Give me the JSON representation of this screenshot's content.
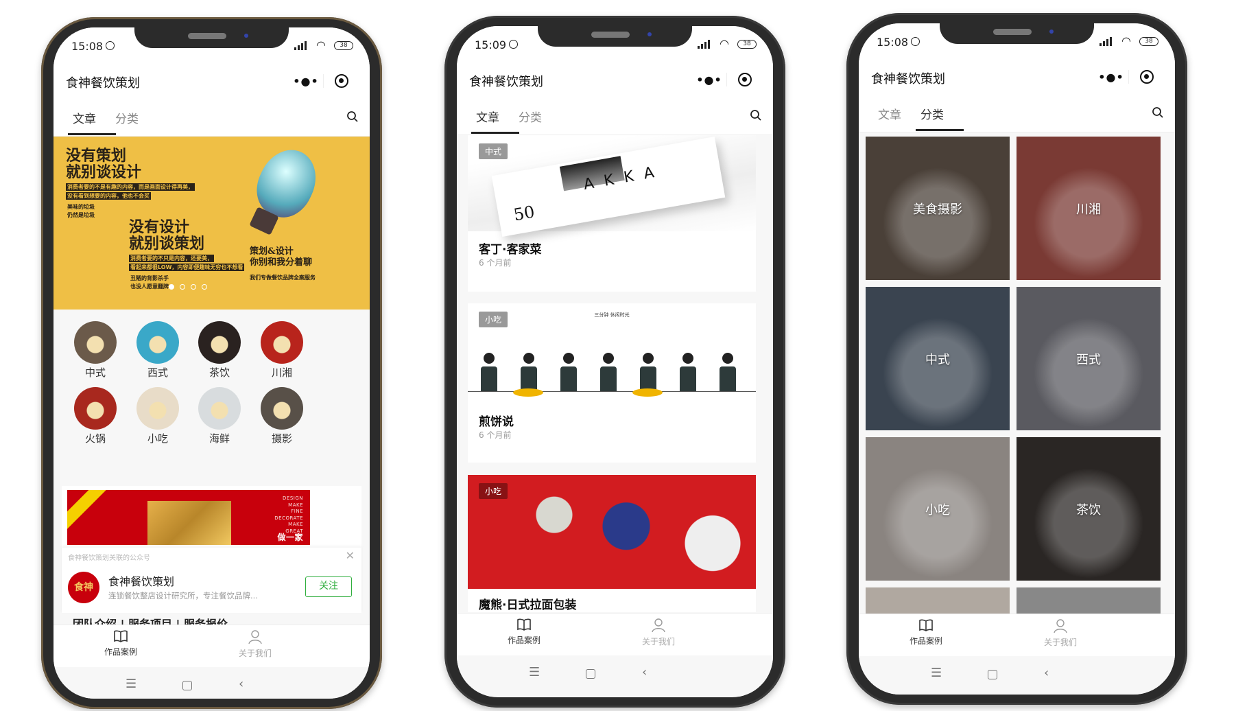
{
  "app": {
    "title": "食神餐饮策划",
    "tabs": [
      "文章",
      "分类"
    ],
    "battery": "38"
  },
  "phones": [
    {
      "time": "15:08",
      "active_tab": 0
    },
    {
      "time": "15:09",
      "active_tab": 0
    },
    {
      "time": "15:08",
      "active_tab": 1
    }
  ],
  "tabbar": {
    "items": [
      {
        "label": "作品案例",
        "icon": "book-icon"
      },
      {
        "label": "关于我们",
        "icon": "person-icon"
      }
    ]
  },
  "navbar": {
    "icons": [
      "menu-icon",
      "home-square-icon",
      "back-chevron-icon"
    ]
  },
  "home": {
    "banner": {
      "headline1": [
        "没有策划",
        "就别谈设计"
      ],
      "sub1": [
        "消费者要的不是有趣的内容，而是画面设计得再美，",
        "没有看到想要的内容，他也不会买"
      ],
      "small1": [
        "美味的垃圾",
        "仍然是垃圾"
      ],
      "headline2": [
        "没有设计",
        "就别谈策划"
      ],
      "sub2": [
        "消费者要的不只是内容，还要美，",
        "看起来都很LOW，内容即便趣味无穷也不想看"
      ],
      "small2": [
        "丑陋的背影杀手",
        "也没人愿意翻牌"
      ],
      "headline3": [
        "策划&设计",
        "你别和我分着聊"
      ],
      "small3": "我们专做餐饮品牌全案服务",
      "slides": 4,
      "active_slide": 1,
      "color": "#efbf45"
    },
    "categories": [
      {
        "label": "中式",
        "color": "#6b5a4a"
      },
      {
        "label": "西式",
        "color": "#3aa8c8"
      },
      {
        "label": "茶饮",
        "color": "#2a2220"
      },
      {
        "label": "川湘",
        "color": "#b8241c"
      },
      {
        "label": "火锅",
        "color": "#a8281e"
      },
      {
        "label": "小吃",
        "color": "#e8dcc8"
      },
      {
        "label": "海鲜",
        "color": "#d8dcde"
      },
      {
        "label": "摄影",
        "color": "#585048"
      }
    ],
    "promo": {
      "words": [
        "DESIGN",
        "MAKE",
        "FINE",
        "DECORATE",
        "MAKE",
        "GREAT",
        "做一家"
      ]
    },
    "follow_card": {
      "header": "食神餐饮策划关联的公众号",
      "avatar_text": "食神",
      "name": "食神餐饮策划",
      "description": "连锁餐饮整店设计研究所，专注餐饮品牌...",
      "button": "关注",
      "accent": "#2fae3d"
    },
    "teaser": "团队介绍 | 服务项目 | 服务报价"
  },
  "articles": [
    {
      "tag": "中式",
      "title": "客丁·客家菜",
      "time": "6 个月前"
    },
    {
      "tag": "小吃",
      "title": "煎饼说",
      "time": "6 个月前"
    },
    {
      "tag": "小吃",
      "title": "魔熊·日式拉面包装"
    }
  ],
  "article_images": {
    "hakka_letters": "A K K A",
    "hakka_number": "50",
    "jianbing_caption": "三分钟 休闲时光"
  },
  "category_grid": [
    {
      "label": "美食摄影",
      "color": "#4a4038"
    },
    {
      "label": "川湘",
      "color": "#7a3a34"
    },
    {
      "label": "中式",
      "color": "#3a4450"
    },
    {
      "label": "西式",
      "color": "#5a5a60"
    },
    {
      "label": "小吃",
      "color": "#8a8480"
    },
    {
      "label": "茶饮",
      "color": "#2a2624"
    }
  ]
}
